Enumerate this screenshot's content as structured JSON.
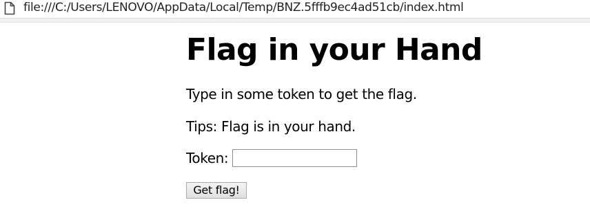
{
  "browser": {
    "url": "file:///C:/Users/LENOVO/AppData/Local/Temp/BNZ.5fffb9ec4ad51cb/index.html",
    "page_icon": "document-icon"
  },
  "page": {
    "title": "Flag in your Hand",
    "instructions": "Type in some token to get the flag.",
    "tips": "Tips: Flag is in your hand.",
    "token_label": "Token:",
    "token_value": "",
    "button_label": "Get flag!"
  }
}
